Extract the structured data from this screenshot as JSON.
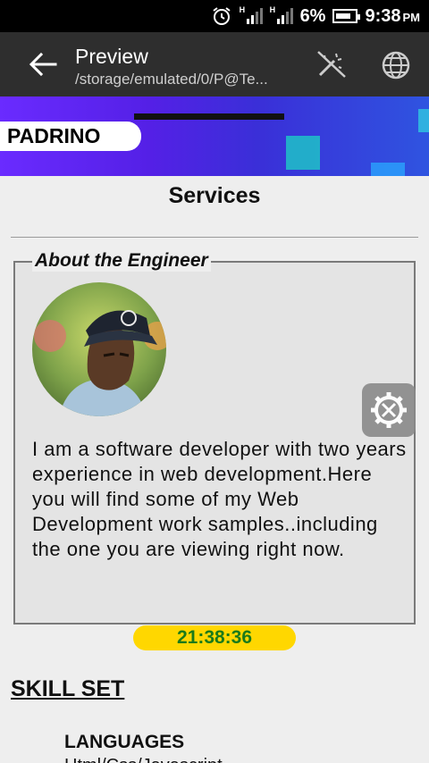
{
  "status_bar": {
    "network_letter_1": "H",
    "network_letter_2": "H",
    "battery_percent": "6%",
    "time": "9:38",
    "ampm": "PM"
  },
  "app_bar": {
    "title": "Preview",
    "subtitle": "/storage/emulated/0/P@Te..."
  },
  "banner": {
    "brand": "PADRINO"
  },
  "page": {
    "section_heading": "Services",
    "about_legend": "About the Engineer",
    "about_text": "I am a software developer with two years experience in web development.Here you will find some of my Web Development work samples..including the one you are viewing right now.",
    "clock": "21:38:36",
    "skill_heading": "SKILL SET",
    "languages_heading": "LANGUAGES",
    "languages_list": "Html/Css/Javascript"
  },
  "colors": {
    "status_bar_bg": "#000000",
    "app_bar_bg": "#2e2e2e",
    "clock_bg": "#ffd700",
    "clock_text": "#1a7a1a",
    "banner_purple": "#6a2bff"
  },
  "icons": {
    "back": "arrow-left-icon",
    "wand": "magic-wand-off-icon",
    "globe": "globe-icon",
    "settings": "gear-wrench-icon",
    "alarm": "alarm-clock-icon"
  }
}
